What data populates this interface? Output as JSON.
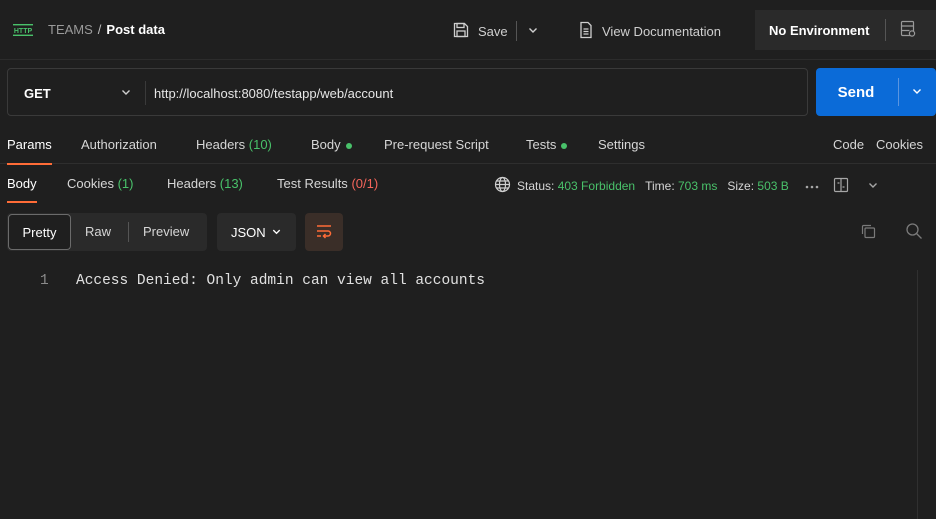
{
  "header": {
    "workspace": "TEAMS",
    "separator": "/",
    "request_name": "Post data",
    "save_label": "Save",
    "view_docs_label": "View Documentation",
    "environment": "No Environment"
  },
  "request": {
    "method": "GET",
    "url": "http://localhost:8080/testapp/web/account",
    "send_label": "Send"
  },
  "request_tabs": {
    "params": "Params",
    "authorization": "Authorization",
    "headers": "Headers",
    "headers_count": "(10)",
    "body": "Body",
    "pre_request": "Pre-request Script",
    "tests": "Tests",
    "settings": "Settings",
    "code": "Code",
    "cookies": "Cookies"
  },
  "response_tabs": {
    "body": "Body",
    "cookies": "Cookies",
    "cookies_count": "(1)",
    "headers": "Headers",
    "headers_count": "(13)",
    "test_results": "Test Results",
    "test_results_count": "(0/1)"
  },
  "response_status": {
    "status_label": "Status:",
    "status_value": "403 Forbidden",
    "time_label": "Time:",
    "time_value": "703 ms",
    "size_label": "Size:",
    "size_value": "503 B"
  },
  "format_toolbar": {
    "pretty": "Pretty",
    "raw": "Raw",
    "preview": "Preview",
    "format": "JSON"
  },
  "response_body": {
    "lines": [
      {
        "number": "1",
        "text": "Access Denied: Only admin can view all accounts"
      }
    ]
  },
  "colors": {
    "accent": "#ff6c37",
    "send_button": "#0b6bd8",
    "success": "#49c16a",
    "error": "#f5655b",
    "link": "#3d8cf3"
  },
  "icons": [
    "http-icon",
    "save-icon",
    "chevron-down-icon",
    "document-icon",
    "environment-icon",
    "globe-icon",
    "more-icon",
    "layout-icon",
    "wrap-icon",
    "copy-icon",
    "search-icon"
  ]
}
